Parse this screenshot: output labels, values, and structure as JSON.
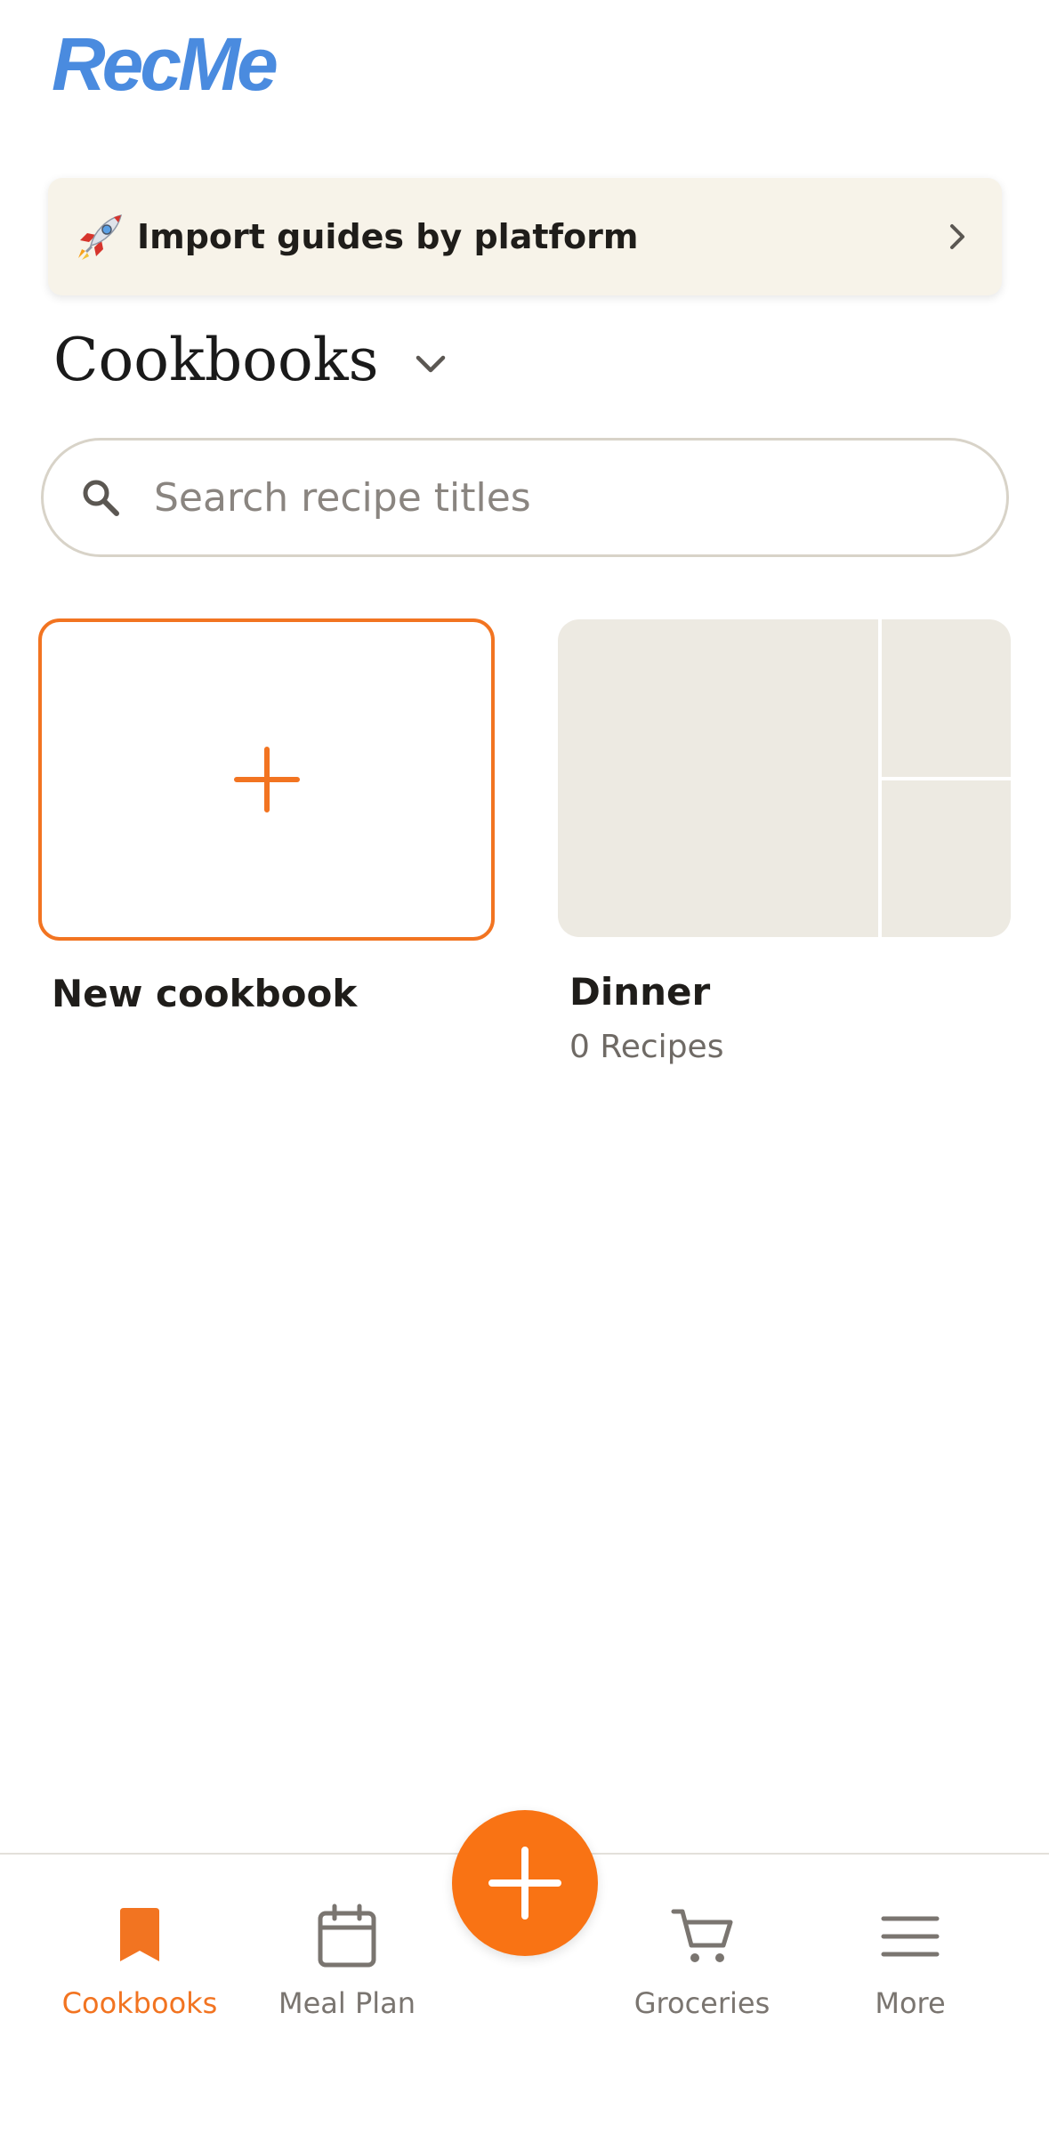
{
  "app": {
    "logo_text": "RecMe"
  },
  "import_banner": {
    "icon": "rocket-icon",
    "label": "Import guides by platform"
  },
  "section": {
    "title": "Cookbooks"
  },
  "search": {
    "placeholder": "Search recipe titles",
    "value": ""
  },
  "cookbooks": {
    "new_label": "New cookbook",
    "items": [
      {
        "name": "Dinner",
        "count_label": "0 Recipes"
      }
    ]
  },
  "nav": {
    "items": [
      {
        "label": "Cookbooks",
        "icon": "bookmark-icon",
        "active": true
      },
      {
        "label": "Meal Plan",
        "icon": "calendar-icon",
        "active": false
      },
      {
        "label": "Groceries",
        "icon": "cart-icon",
        "active": false
      },
      {
        "label": "More",
        "icon": "menu-icon",
        "active": false
      }
    ],
    "fab_icon": "plus-icon"
  },
  "colors": {
    "accent": "#f27421",
    "fab": "#f97314",
    "logo": "#4a8bdf",
    "banner_bg": "#f7f3e9",
    "placeholder_tile": "#edeae2",
    "inactive_nav": "#7a7570"
  }
}
